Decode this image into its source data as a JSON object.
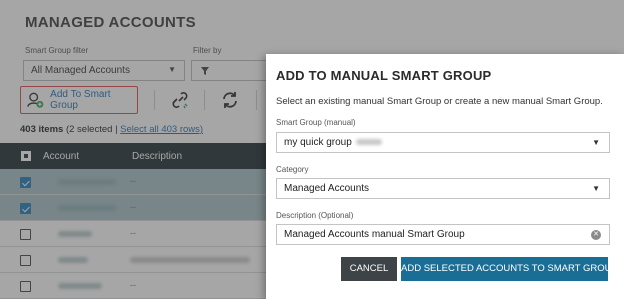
{
  "page": {
    "title": "MANAGED ACCOUNTS",
    "smart_group_filter_label": "Smart Group filter",
    "smart_group_filter_value": "All Managed Accounts",
    "filter_by_label": "Filter by",
    "add_to_smart_group_label": "Add To Smart Group",
    "items_count": "403 items",
    "selected_text": "(2 selected |",
    "select_all_link": "Select all 403 rows)"
  },
  "grid": {
    "columns": [
      "Account",
      "Description"
    ],
    "rows": [
      {
        "selected": true,
        "description": "--"
      },
      {
        "selected": true,
        "description": "--"
      },
      {
        "selected": false,
        "description": "--"
      },
      {
        "selected": false,
        "description": ""
      },
      {
        "selected": false,
        "description": "--"
      }
    ]
  },
  "modal": {
    "title": "ADD TO MANUAL SMART GROUP",
    "description": "Select an existing manual Smart Group or create a new manual Smart Group.",
    "smart_group_label": "Smart Group (manual)",
    "smart_group_value": "my quick group",
    "category_label": "Category",
    "category_value": "Managed Accounts",
    "description_label": "Description (Optional)",
    "description_value": "Managed Accounts manual Smart Group",
    "cancel_label": "CANCEL",
    "add_label": "ADD SELECTED ACCOUNTS TO SMART GROUP"
  },
  "icons": {
    "add_smart_group": "group-add-icon",
    "unlink": "unlink-icon",
    "sync": "sync-icon",
    "filter": "filter-icon",
    "dropdown": "chevron-down-icon",
    "clear": "clear-icon"
  },
  "colors": {
    "header_dark": "#1e2c33",
    "primary_button": "#1a6e96",
    "cancel_button": "#3d4347",
    "selected_row": "#a7c1c7",
    "highlight_border": "#e0474c",
    "link": "#1f6fb2"
  }
}
